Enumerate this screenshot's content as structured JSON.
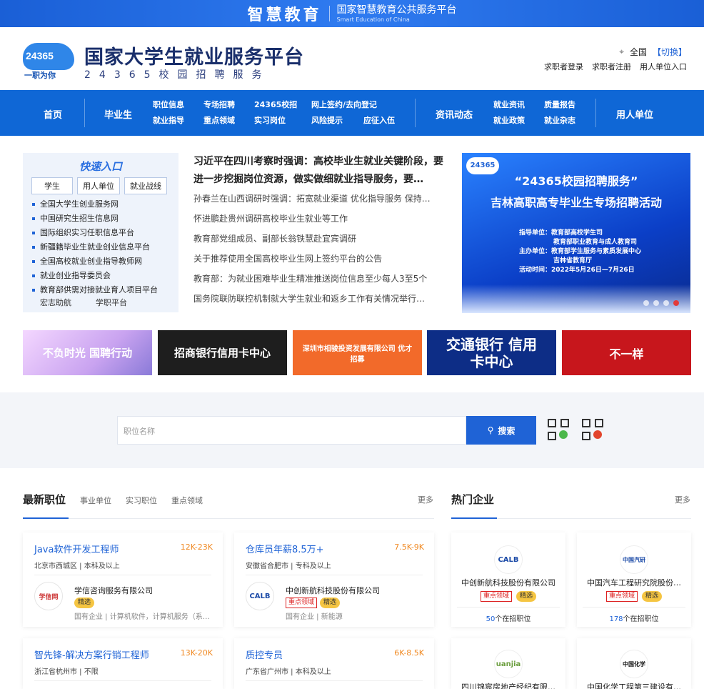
{
  "topbar": {
    "brand": "智慧教育",
    "platform": "国家智慧教育公共服务平台",
    "platform_en": "Smart Education of China"
  },
  "header": {
    "logo_number": "24365",
    "logo_slogan": "一职为你",
    "title": "国家大学生就业服务平台",
    "subtitle": "24365校园招聘服务",
    "region": "全国",
    "switch": "【切换】",
    "user_links": [
      "求职者登录",
      "求职者注册",
      "用人单位入口"
    ]
  },
  "nav": {
    "home": "首页",
    "graduates": "毕业生",
    "sub1": [
      "职位信息",
      "就业指导"
    ],
    "sub2": [
      "专场招聘",
      "重点领域"
    ],
    "sub3": [
      "24365校招",
      "实习岗位"
    ],
    "sub4": [
      "网上签约/去向登记",
      "风险提示"
    ],
    "sub5": "应征入伍",
    "news": "资讯动态",
    "sub6": [
      "就业资讯",
      "就业政策"
    ],
    "sub7": [
      "质量报告",
      "就业杂志"
    ],
    "employers": "用人单位"
  },
  "quick": {
    "title": "快速入口",
    "tabs": [
      "学生",
      "用人单位",
      "就业战线"
    ],
    "links": [
      "全国大学生创业服务网",
      "中国研究生招生信息网",
      "国际组织实习任职信息平台",
      "新疆籍毕业生就业创业信息平台",
      "全国高校就业创业指导教师网",
      "就业创业指导委员会",
      "教育部供需对接就业育人项目平台"
    ],
    "last": [
      "宏志助航",
      "学职平台"
    ]
  },
  "news": {
    "lead": "习近平在四川考察时强调：高校毕业生就业关键阶段，要进一步挖掘岗位资源，做实做细就业指导服务，要…",
    "items": [
      "孙春兰在山西调研时强调：拓宽就业渠道 优化指导服务 保持…",
      "怀进鹏赴贵州调研高校毕业生就业等工作",
      "教育部党组成员、副部长翁铁慧赴宜宾调研",
      "关于推荐使用全国高校毕业生网上签约平台的公告",
      "教育部：为就业困难毕业生精准推送岗位信息至少每人3至5个",
      "国务院联防联控机制就大学生就业和返乡工作有关情况举行…"
    ]
  },
  "banner": {
    "line1": "“24365校园招聘服务”",
    "line2": "吉林高职高专毕业生专场招聘活动",
    "info": [
      "指导单位：教育部高校学生司",
      "教育部职业教育与成人教育司",
      "主办单位：教育部学生服务与素质发展中心",
      "吉林省教育厅",
      "活动时间：2022年5月26日—7月26日"
    ],
    "logo": "24365",
    "slide_index": 4,
    "slide_count": 4
  },
  "ads": [
    "不负时光 国聘行动",
    "招商银行信用卡中心",
    "深圳市相骏投资发展有限公司 优才招募",
    "交通银行 信用卡中心",
    "不一样"
  ],
  "search": {
    "placeholder": "职位名称",
    "button": "搜索",
    "qr1": "wechat-qr",
    "qr2": "weibo-qr"
  },
  "latest": {
    "title": "最新职位",
    "tabs": [
      "事业单位",
      "实习职位",
      "重点领域"
    ],
    "more": "更多"
  },
  "hot": {
    "title": "热门企业",
    "more": "更多"
  },
  "jobs": [
    {
      "title": "Java软件开发工程师",
      "salary": "12K-23K",
      "loc": "北京市西城区 | 本科及以上",
      "company": "学信咨询服务有限公司",
      "logo": "学信网",
      "tags": [
        "精选"
      ],
      "info": "国有企业 | 计算机软件，计算机服务（系…"
    },
    {
      "title": "仓库员年薪8.5万+",
      "salary": "7.5K-9K",
      "loc": "安徽省合肥市 | 专科及以上",
      "company": "中创新航科技股份有限公司",
      "logo": "CALB",
      "tags": [
        "重点领域",
        "精选"
      ],
      "info": "国有企业 | 新能源"
    },
    {
      "title": "智先锋-解决方案行销工程师",
      "salary": "13K-20K",
      "loc": "浙江省杭州市 | 不限"
    },
    {
      "title": "质控专员",
      "salary": "6K-8.5K",
      "loc": "广东省广州市 | 本科及以上"
    }
  ],
  "companies": [
    {
      "name": "中创新航科技股份有限公司",
      "logo": "CALB",
      "tags": [
        "重点领域",
        "精选"
      ],
      "count": "50",
      "count_suffix": "个在招职位"
    },
    {
      "name": "中国汽车工程研究院股份…",
      "logo": "中国汽研",
      "tags": [
        "重点领域",
        "精选"
      ],
      "count": "178",
      "count_suffix": "个在招职位"
    },
    {
      "name": "四川锦宸房地产经纪有限…",
      "logo": "uanjia"
    },
    {
      "name": "中国化学工程第三建设有…",
      "logo": "中国化学"
    }
  ],
  "colors": {
    "primary": "#1f63d6",
    "nav": "#0f67d6",
    "salary": "#f08a24",
    "tag_red": "#dd2222",
    "tag_gold": "#f5c542"
  }
}
